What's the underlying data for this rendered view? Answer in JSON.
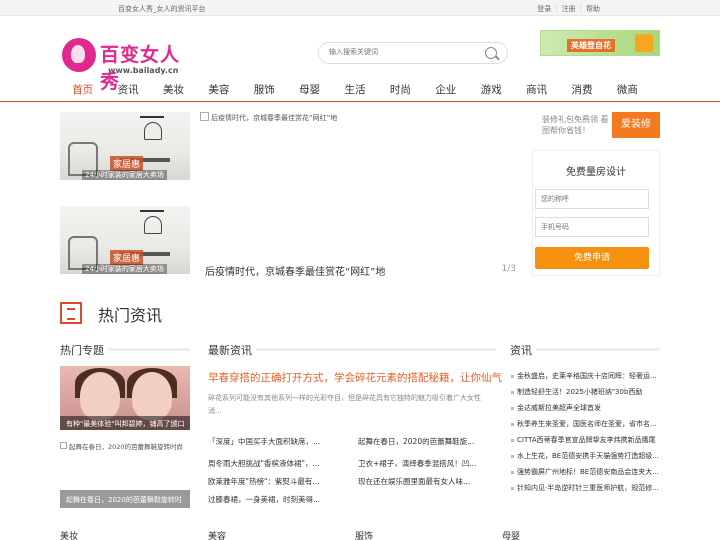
{
  "topbar": {
    "tagline": "百变女人秀_女人的资讯平台",
    "links": [
      "登录",
      "注册",
      "帮助"
    ]
  },
  "logo": {
    "name": "百变女人秀",
    "url": "www.bailady.cn"
  },
  "search": {
    "placeholder": "输入搜索关键词"
  },
  "banner_ad": {
    "text": "英雄登自花"
  },
  "nav": {
    "items": [
      "首页",
      "资讯",
      "美妆",
      "美容",
      "服饰",
      "母婴",
      "生活",
      "时尚",
      "企业",
      "游戏",
      "商讯",
      "消费",
      "微商"
    ],
    "active": 0
  },
  "slider": {
    "thumb_label": "家居惠",
    "thumb_sub": "24小时家装的家居大卖场",
    "main_alt": "后疫情时代，京城春季最佳赏花“网红”地",
    "caption": "后疫情时代，京城春季最佳赏花“网红”地",
    "counter": "1/3"
  },
  "side_ad": {
    "text": "装修礼包免费领 看图帮你省钱！",
    "button": "爱装修"
  },
  "design_form": {
    "title": "免费量房设计",
    "name_placeholder": "您的称呼",
    "phone_placeholder": "手机号码",
    "submit": "免费申请"
  },
  "section": {
    "title": "热门资讯"
  },
  "columns": {
    "hot": "热门专题",
    "latest": "最新资讯",
    "news": "资讯"
  },
  "hot": {
    "card1": "有种\"最美体验\"叫邦碧婷，铺高了颁口",
    "card2": "起舞在春日，2020的芭蕾舞鞋旋转时尚",
    "card3": "起舞在春日，2020的芭蕾舞鞋旋转时"
  },
  "latest": {
    "headline": "早春穿搭的正确打开方式，学会碎花元素的搭配秘籍，让你仙气",
    "desc": "碎花系列可能没有其他系列一样的光彩夺目，但是碎花具有它独特的魅力吸引着广大女性消...",
    "items": [
      "「深度」中国买手大面积缺席，...",
      "起舞在春日，2020的芭蕾舞鞋旋...",
      "周冬雨大胆挑战\"香槟液体裙\"，...",
      "卫衣+裙子，演绎春季混搭风！凹...",
      "欧莱雅年度\"热榜\"：紫熨斗最有...",
      "现在还在娱乐圈里面最有女人味...",
      "过膝春裙，一身美裙，时刻美得..."
    ]
  },
  "news": {
    "items": [
      "金秋盛启，史莱辛格国庆十店同辉：轻奢运...",
      "制造轻舒生活！2025小猪班纳\"30b西励",
      "金达威斯拉美超声全球首发",
      "秋季养生来圣爱，国医名师在圣爱，省市名...",
      "CITTA西蒂春季官宣品牌挚友李炜携新品鹰尾",
      "水上生花，BE范德安携手天猫强势打造超级...",
      "强势霸屏广州地标！BE范德安南品会连夹大...",
      "针知内见·半岛逆时针三重医师护航，规范修..."
    ]
  },
  "footer_cats": [
    "美妆",
    "美容",
    "服饰",
    "母婴"
  ]
}
